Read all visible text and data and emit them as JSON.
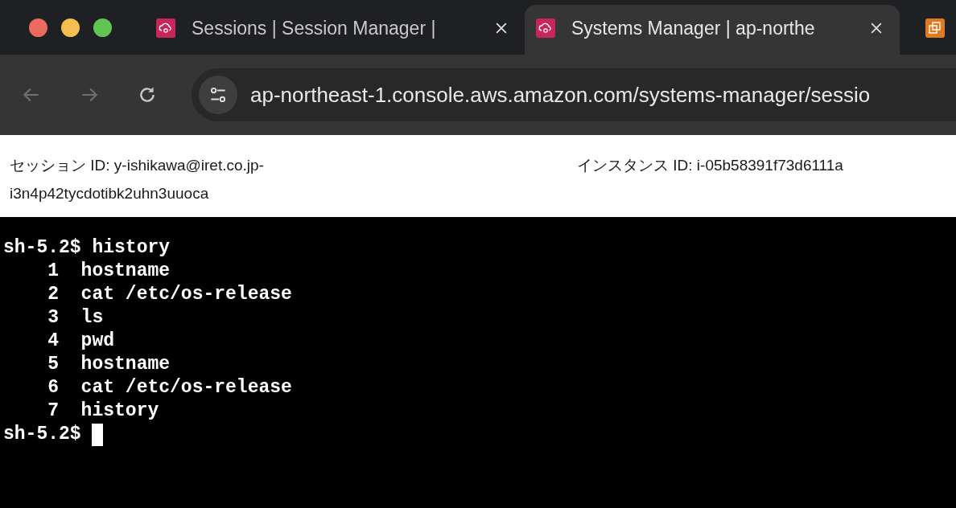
{
  "tabs": [
    {
      "title": "Sessions | Session Manager |",
      "selected": false
    },
    {
      "title": "Systems Manager | ap-northe",
      "selected": true
    },
    {
      "selected": false
    }
  ],
  "address_bar": {
    "url": "ap-northeast-1.console.aws.amazon.com/systems-manager/sessio"
  },
  "session_info": [
    {
      "label": "セッション ID:",
      "value": "y-ishikawa@iret.co.jp-i3n4p42tycdotibk2uhn3uuoca"
    },
    {
      "label": "インスタンス ID:",
      "value": "i-05b58391f73d6111a"
    }
  ],
  "terminal": {
    "lines": [
      "sh-5.2$ history",
      "    1  hostname",
      "    2  cat /etc/os-release",
      "    3  ls",
      "    4  pwd",
      "    5  hostname",
      "    6  cat /etc/os-release",
      "    7  history"
    ],
    "prompt": "sh-5.2$ ",
    "cursor": true
  }
}
